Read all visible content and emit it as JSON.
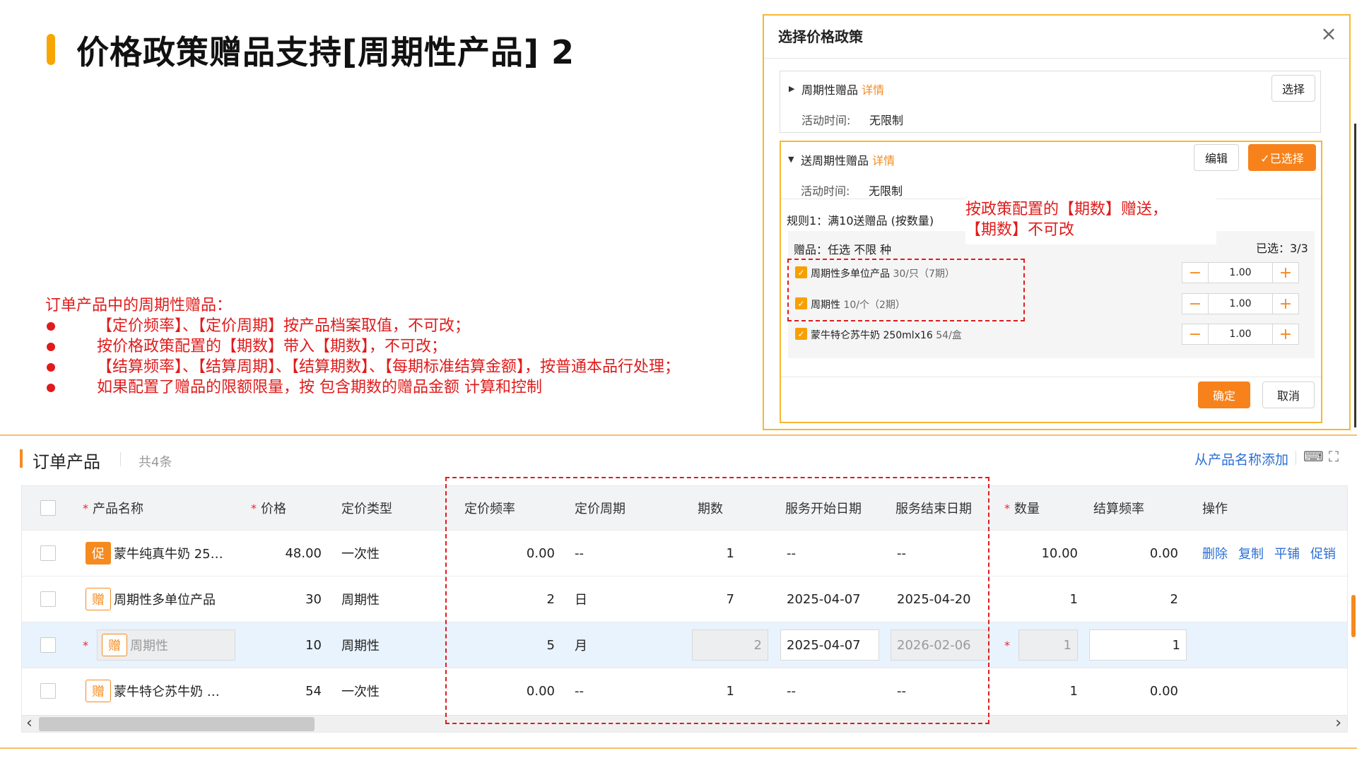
{
  "title": "价格政策赠品支持[周期性产品] 2",
  "notes": {
    "intro": "订单产品中的周期性赠品：",
    "items": [
      "【定价频率】、【定价周期】按产品档案取值，不可改；",
      "按价格政策配置的【期数】带入【期数】，不可改；",
      "【结算频率】、【结算周期】、【结算期数】、【每期标准结算金额】，按普通本品行处理；",
      "如果配置了赠品的限额限量，按 包含期数的赠品金额 计算和控制"
    ]
  },
  "modal": {
    "title": "选择价格政策",
    "close_icon": "close-icon",
    "policy1": {
      "name": "周期性赠品",
      "detail": "详情",
      "time_label": "活动时间:",
      "time_value": "无限制",
      "select_btn": "选择"
    },
    "policy2": {
      "name": "送周期性赠品",
      "detail": "详情",
      "time_label": "活动时间:",
      "time_value": "无限制",
      "edit_btn": "编辑",
      "selected_btn": "✓已选择",
      "rule": "规则1：满10送赠品 (按数量)",
      "gift_label": "赠品：任选 不限 种",
      "selected_count": "已选：3/3",
      "gifts": [
        {
          "name": "周期性多单位产品",
          "spec": "30/只（7期）",
          "qty": "1.00"
        },
        {
          "name": "周期性",
          "spec": "10/个（2期）",
          "qty": "1.00"
        },
        {
          "name": "蒙牛特仑苏牛奶 250mlx16",
          "spec": "54/盒",
          "qty": "1.00"
        }
      ]
    },
    "confirm_btn": "确定",
    "cancel_btn": "取消",
    "annotation": [
      "按政策配置的【期数】赠送，",
      "【期数】不可改"
    ]
  },
  "order": {
    "section_title": "订单产品",
    "count": "共4条",
    "add_link": "从产品名称添加",
    "columns": [
      "产品名称",
      "价格",
      "定价类型",
      "定价频率",
      "定价周期",
      "期数",
      "服务开始日期",
      "服务结束日期",
      "数量",
      "结算频率",
      "操作"
    ],
    "rows": [
      {
        "tag": "促",
        "name": "蒙牛纯真牛奶 25…",
        "price": "48.00",
        "price_type": "一次性",
        "freq": "0.00",
        "period": "--",
        "periods": "1",
        "start": "--",
        "end": "--",
        "qty": "10.00",
        "settle_freq": "0.00",
        "ops": [
          "删除",
          "复制",
          "平铺",
          "促销"
        ]
      },
      {
        "tag": "赠",
        "name": "周期性多单位产品",
        "price": "30",
        "price_type": "周期性",
        "freq": "2",
        "period": "日",
        "periods": "7",
        "start": "2025-04-07",
        "end": "2025-04-20",
        "qty": "1",
        "settle_freq": "2"
      },
      {
        "tag": "赠",
        "name": "周期性",
        "price": "10",
        "price_type": "周期性",
        "freq": "5",
        "period": "月",
        "periods": "2",
        "start": "2025-04-07",
        "end": "2026-02-06",
        "qty": "1",
        "settle_freq": "1"
      },
      {
        "tag": "赠",
        "name": "蒙牛特仑苏牛奶 …",
        "price": "54",
        "price_type": "一次性",
        "freq": "0.00",
        "period": "--",
        "periods": "1",
        "start": "--",
        "end": "--",
        "qty": "1",
        "settle_freq": "0.00"
      }
    ]
  }
}
